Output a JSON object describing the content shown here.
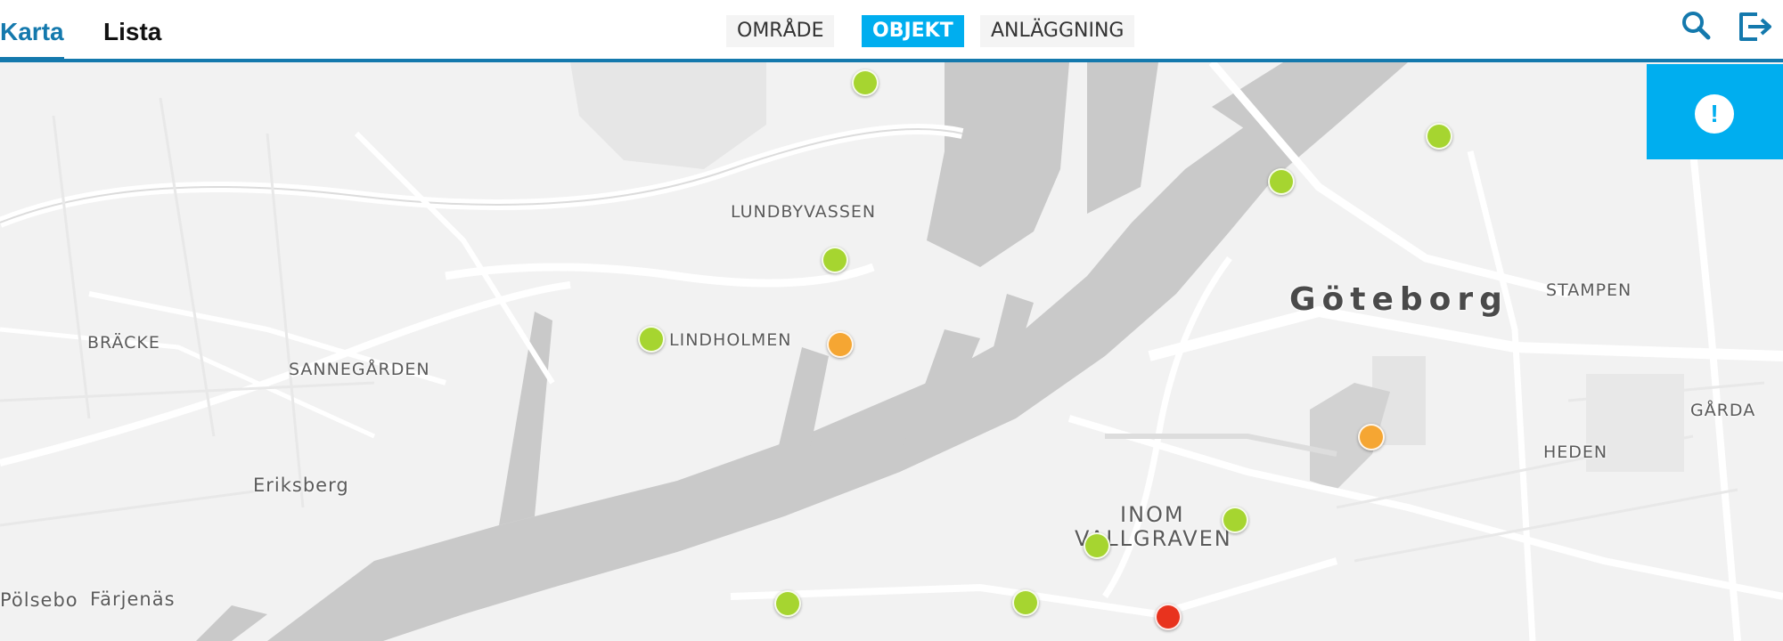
{
  "header": {
    "tabs": [
      {
        "label": "Karta",
        "active": true
      },
      {
        "label": "Lista",
        "active": false
      }
    ],
    "filters": [
      {
        "label": "OMRÅDE",
        "active": false
      },
      {
        "label": "OBJEKT",
        "active": true
      },
      {
        "label": "ANLÄGGNING",
        "active": false
      }
    ],
    "icons": [
      "search-icon",
      "logout-icon"
    ]
  },
  "colors": {
    "accent": "#1479ad",
    "active_filter": "#00aeef",
    "marker_green": "#a6d530",
    "marker_orange": "#f5a633",
    "marker_red": "#e8331e",
    "water": "#c9c9c9"
  },
  "map": {
    "labels": {
      "lundbyvassen": "LUNDBYVASSEN",
      "lindholmen": "LINDHOLMEN",
      "bracke": "BRÄCKE",
      "sannegarden": "SANNEGÅRDEN",
      "eriksberg": "Eriksberg",
      "polsebo": "Pölsebo",
      "farjenas": "Färjenäs",
      "goteborg": "Göteborg",
      "stampen": "STAMPEN",
      "garda": "GÅRDA",
      "heden": "HEDEN",
      "inom": "INOM",
      "vallgraven": "VALLGRAVEN"
    },
    "markers": [
      {
        "status": "green"
      },
      {
        "status": "green"
      },
      {
        "status": "green"
      },
      {
        "status": "green"
      },
      {
        "status": "green"
      },
      {
        "status": "orange"
      },
      {
        "status": "orange"
      },
      {
        "status": "green"
      },
      {
        "status": "green"
      },
      {
        "status": "green"
      },
      {
        "status": "green"
      },
      {
        "status": "red"
      }
    ]
  },
  "alert": {
    "icon": "exclamation-icon",
    "symbol": "!"
  }
}
